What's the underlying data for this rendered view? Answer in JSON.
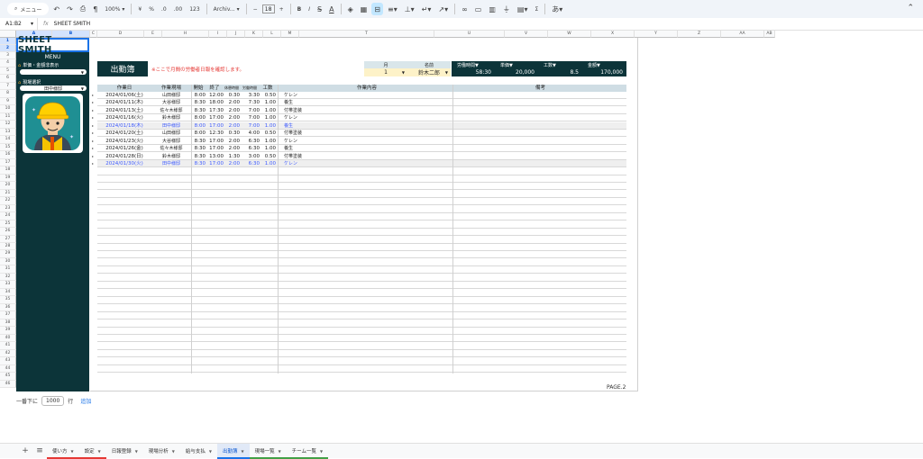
{
  "toolbar": {
    "menu_label": "メニュー",
    "zoom": "100%",
    "currency": "¥",
    "percent": "%",
    "decimals_dec": ".0",
    "decimals_inc": ".00",
    "number_format": "123",
    "font": "Archiv...",
    "font_size": "18",
    "minus": "−",
    "plus": "+",
    "bold": "B",
    "italic": "I",
    "sigma": "Σ"
  },
  "formula_bar": {
    "cell_ref": "A1:B2",
    "fx": "fx",
    "content": "SHEET SMITH"
  },
  "columns": [
    "A",
    "B",
    "C",
    "D",
    "E",
    "H",
    "I",
    "J",
    "K",
    "L",
    "M",
    "T",
    "U",
    "V",
    "W",
    "X",
    "Y",
    "Z",
    "AA",
    "AB"
  ],
  "rows": [
    "1",
    "2",
    "3",
    "4",
    "5",
    "6",
    "7",
    "8",
    "9",
    "10",
    "11",
    "12",
    "13",
    "14",
    "15",
    "16",
    "17",
    "18",
    "19",
    "20",
    "21",
    "22",
    "23",
    "24",
    "25",
    "26",
    "27",
    "28",
    "29",
    "30",
    "31",
    "32",
    "33",
    "34",
    "35",
    "36",
    "37",
    "38",
    "39",
    "40",
    "41",
    "42",
    "43",
    "44",
    "45",
    "46"
  ],
  "left_panel": {
    "logo": "SHEET SMITH",
    "menu": "MENU",
    "toggle_label": "単価・金額非表示",
    "toggle_value": "",
    "site_label": "現場選択",
    "site_value": "田中様邸"
  },
  "sheet": {
    "title": "出勤簿",
    "notice": "※ここで月間の労働者日報を確認します。",
    "info_headers": [
      "月",
      "名前",
      "労働時間▼",
      "単価▼",
      "工数▼",
      "金額▼"
    ],
    "info_values": [
      "1",
      "鈴木二郎",
      "58:30",
      "20,000",
      "8.5",
      "170,000"
    ],
    "table_headers": [
      "作業日",
      "作業現場",
      "開始",
      "終了",
      "休憩時間",
      "労働時間",
      "工数",
      "作業内容",
      "備考"
    ],
    "rows": [
      {
        "date": "2024/01/06(土)",
        "site": "山田様邸",
        "start": "8:00",
        "end": "12:00",
        "break": "0:30",
        "hours": "3:30",
        "work": "0.50",
        "task": "ケレン",
        "note": ""
      },
      {
        "date": "2024/01/11(木)",
        "site": "大谷様邸",
        "start": "8:30",
        "end": "18:00",
        "break": "2:00",
        "hours": "7:30",
        "work": "1.00",
        "task": "養生",
        "note": ""
      },
      {
        "date": "2024/01/13(土)",
        "site": "佐々木様邸",
        "start": "8:30",
        "end": "17:30",
        "break": "2:00",
        "hours": "7:00",
        "work": "1.00",
        "task": "付帯塗装",
        "note": ""
      },
      {
        "date": "2024/01/16(火)",
        "site": "鈴木様邸",
        "start": "8:00",
        "end": "17:00",
        "break": "2:00",
        "hours": "7:00",
        "work": "1.00",
        "task": "ケレン",
        "note": ""
      },
      {
        "date": "2024/01/18(木)",
        "site": "田中様邸",
        "start": "8:00",
        "end": "17:00",
        "break": "2:00",
        "hours": "7:00",
        "work": "1.00",
        "task": "養生",
        "note": ""
      },
      {
        "date": "2024/01/20(土)",
        "site": "山田様邸",
        "start": "8:00",
        "end": "12:30",
        "break": "0:30",
        "hours": "4:00",
        "work": "0.50",
        "task": "付帯塗装",
        "note": ""
      },
      {
        "date": "2024/01/23(火)",
        "site": "大谷様邸",
        "start": "8:30",
        "end": "17:00",
        "break": "2:00",
        "hours": "6:30",
        "work": "1.00",
        "task": "ケレン",
        "note": ""
      },
      {
        "date": "2024/01/26(金)",
        "site": "佐々木様邸",
        "start": "8:30",
        "end": "17:00",
        "break": "2:00",
        "hours": "6:30",
        "work": "1.00",
        "task": "養生",
        "note": ""
      },
      {
        "date": "2024/01/28(日)",
        "site": "鈴木様邸",
        "start": "8:30",
        "end": "13:00",
        "break": "1:30",
        "hours": "3:00",
        "work": "0.50",
        "task": "付帯塗装",
        "note": ""
      },
      {
        "date": "2024/01/30(火)",
        "site": "田中様邸",
        "start": "8:30",
        "end": "17:00",
        "break": "2:00",
        "hours": "6:30",
        "work": "1.00",
        "task": "ケレン",
        "note": ""
      }
    ],
    "highlight_rows": [
      4,
      9
    ],
    "page_label": "PAGE.2"
  },
  "add_rows": {
    "prefix": "一番下に",
    "count": "1000",
    "unit": "行",
    "button": "追加"
  },
  "tabs": {
    "add": "+",
    "list": "≡",
    "items": [
      {
        "label": "使い方",
        "bar": "#e53935"
      },
      {
        "label": "設定",
        "bar": "#e53935"
      },
      {
        "label": "日報登録",
        "bar": ""
      },
      {
        "label": "現場分析",
        "bar": ""
      },
      {
        "label": "給与支払",
        "bar": ""
      },
      {
        "label": "出勤簿",
        "bar": "#1a73e8",
        "active": true
      },
      {
        "label": "現場一覧",
        "bar": "#43a047"
      },
      {
        "label": "チーム一覧",
        "bar": "#43a047"
      }
    ]
  },
  "colors": {
    "panel": "#0c3439",
    "accent": "#1a73e8",
    "notice": "#e53935",
    "highlight_text": "#3d5afe"
  }
}
